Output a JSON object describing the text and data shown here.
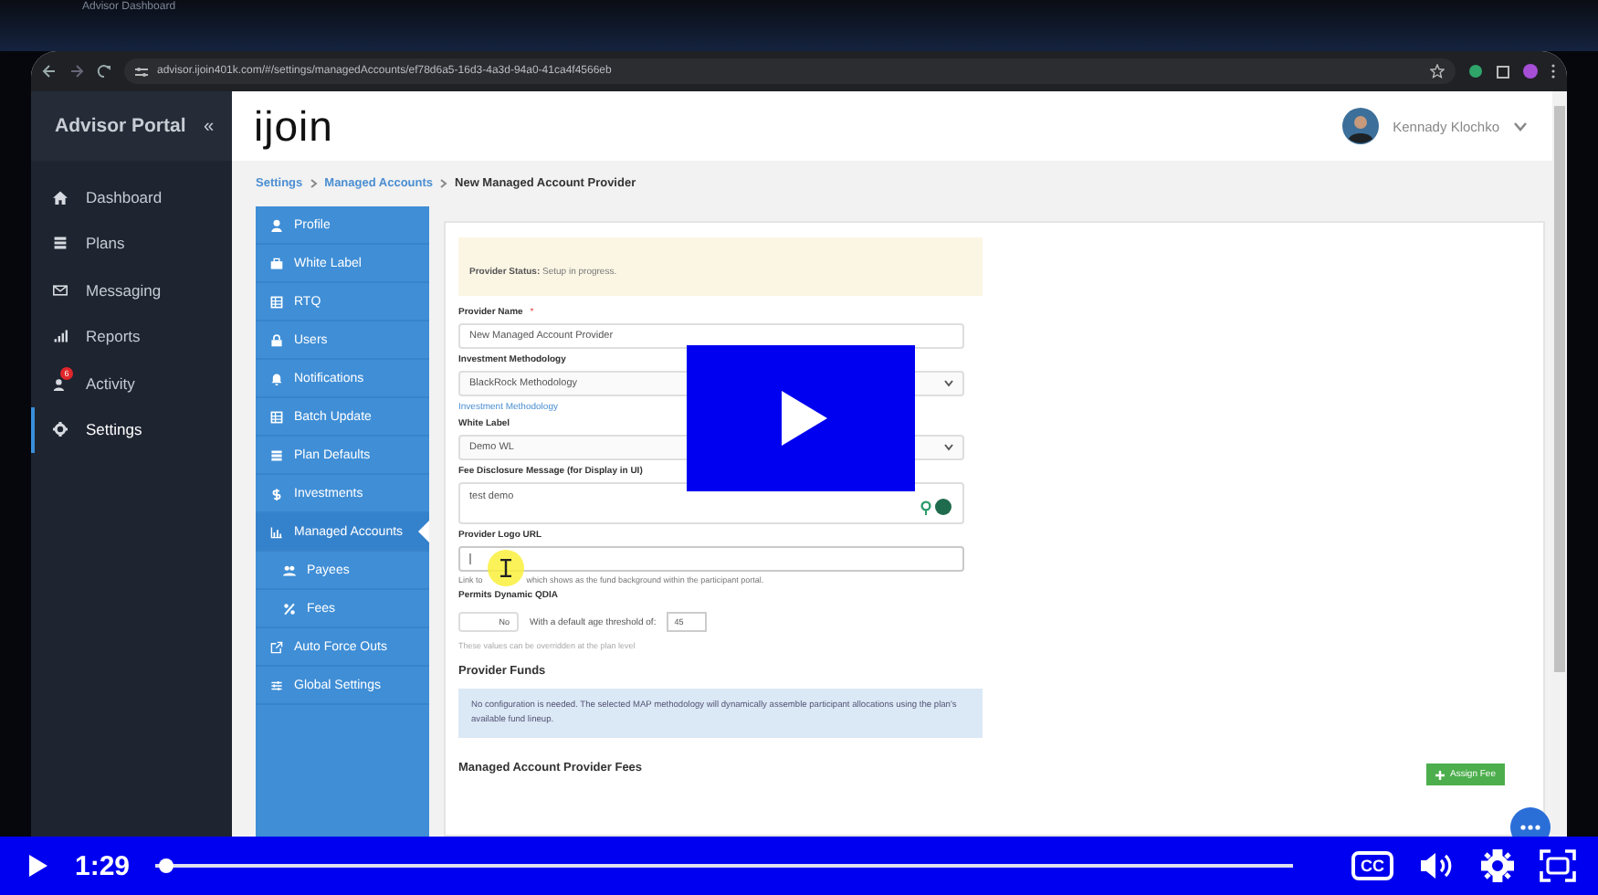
{
  "browser": {
    "tab_title": "Advisor Dashboard",
    "url": "advisor.ijoin401k.com/#/settings/managedAccounts/ef78d6a5-16d3-4a3d-94a0-41ca4f4566eb"
  },
  "sidebar": {
    "title": "Advisor Portal",
    "collapse": "«",
    "items": [
      {
        "label": "Dashboard",
        "selected": false
      },
      {
        "label": "Plans",
        "selected": false
      },
      {
        "label": "Messaging",
        "selected": false
      },
      {
        "label": "Reports",
        "selected": false
      },
      {
        "label": "Activity",
        "badge": "6",
        "selected": false
      },
      {
        "label": "Settings",
        "selected": true
      }
    ]
  },
  "header": {
    "logo": "ijoin",
    "user": "Kennady Klochko"
  },
  "breadcrumb": [
    "Settings",
    "Managed Accounts",
    "New Managed Account Provider"
  ],
  "submenu": [
    {
      "label": "Profile",
      "selected": false
    },
    {
      "label": "White Label",
      "selected": false
    },
    {
      "label": "RTQ",
      "selected": false
    },
    {
      "label": "Users",
      "selected": false
    },
    {
      "label": "Notifications",
      "selected": false
    },
    {
      "label": "Batch Update",
      "selected": false
    },
    {
      "label": "Plan Defaults",
      "selected": false
    },
    {
      "label": "Investments",
      "selected": false
    },
    {
      "label": "Managed Accounts",
      "selected": true,
      "children": [
        {
          "label": "Payees",
          "selected": false
        },
        {
          "label": "Fees",
          "selected": false
        }
      ]
    },
    {
      "label": "Auto Force Outs",
      "selected": false
    },
    {
      "label": "Global Settings",
      "selected": false
    }
  ],
  "status": {
    "label": "Provider Status:",
    "value": "Setup in progress."
  },
  "fields": [
    {
      "kind": "text",
      "label": "Provider Name",
      "required_mark": "*",
      "value": "New Managed Account Provider"
    },
    {
      "kind": "select",
      "label": "Investment Methodology",
      "value": "BlackRock Methodology",
      "link": "Investment Methodology"
    },
    {
      "kind": "select",
      "label": "White Label",
      "value": "Demo WL"
    },
    {
      "kind": "textarea",
      "label": "Fee Disclosure Message (for Display in UI)",
      "value": "test demo"
    },
    {
      "kind": "url",
      "label": "Provider Logo URL",
      "hint_start": "Link to",
      "hint_end": "which shows as the fund background within the participant portal."
    },
    {
      "kind": "toggle",
      "label": "Permits Dynamic QDIA",
      "on": false,
      "toggle_text": "No",
      "threshold_label": "With a default age threshold of:",
      "threshold": "45",
      "note": "These values can be overridden at the plan level"
    }
  ],
  "funds": {
    "title": "Provider Funds",
    "message": "No configuration is needed. The selected MAP methodology will dynamically assemble participant allocations using the plan's available fund lineup."
  },
  "fees": {
    "title": "Managed Account Provider Fees",
    "button": "Assign Fee"
  },
  "player": {
    "time": "1:29",
    "level": 0.003,
    "cc": "CC"
  }
}
